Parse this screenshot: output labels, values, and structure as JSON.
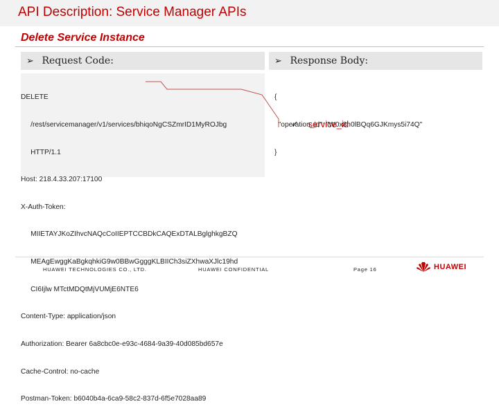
{
  "header": {
    "title": "API Description: Service Manager APIs"
  },
  "section": {
    "subtitle": "Delete Service Instance"
  },
  "request": {
    "heading": "Request Code:",
    "lines": [
      "DELETE",
      "     /rest/servicemanager/v1/services/bhiqoNgCSZmrID1MyROJbg",
      "     HTTP/1.1",
      "Host: 218.4.33.207:17100",
      "X-Auth-Token:",
      "     MIIETAYJKoZIhvcNAQcCoIIEPTCCBDkCAQExDTALBglghkgBZQ",
      "     MEAgEwggKaBgkqhkiG9w0BBwGgggKLBIICh3siZXhwaXJlc19hd",
      "     CI6Ijlw MTctMDQtMjVUMjE6NTE6",
      "Content-Type: application/json",
      "Authorization: Bearer 6a8cbc0e-e93c-4684-9a39-40d085bd657e",
      "Cache-Control: no-cache",
      "Postman-Token: b6040b4a-6ca9-58c2-837d-6f5e7028aa89"
    ]
  },
  "response": {
    "heading": "Response Body:",
    "lines": [
      "{",
      "  \"operation_id\": \"W0x8h0lBQq6GJKmys5i74Q\"",
      "}"
    ],
    "field": "service_id"
  },
  "footer": {
    "company": "HUAWEI TECHNOLOGIES CO., LTD.",
    "confidential": "HUAWEI CONFIDENTIAL",
    "page": "Page 16",
    "logo_text": "HUAWEI"
  },
  "colors": {
    "accent": "#c00000",
    "panel": "#e6e6e6",
    "code_bg": "#f2f2f2"
  }
}
